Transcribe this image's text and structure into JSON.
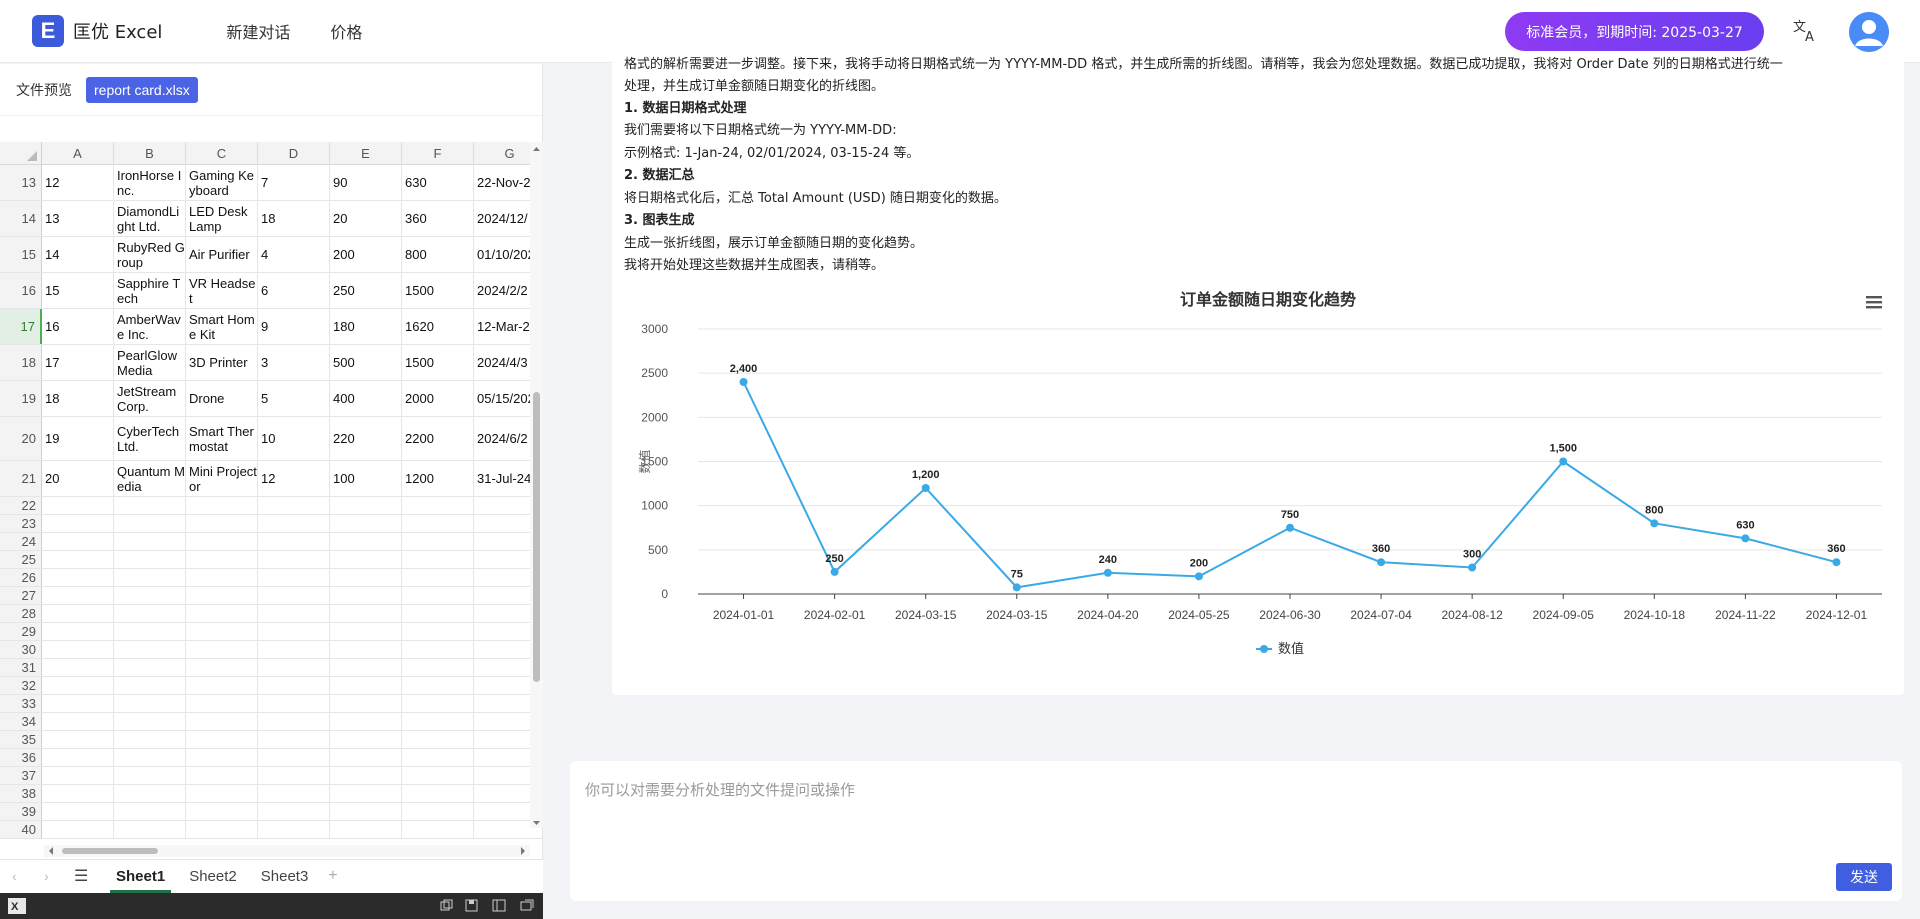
{
  "app": {
    "logo_letter": "E",
    "name": "匡优 Excel",
    "nav": [
      "新建对话",
      "价格"
    ],
    "member_badge": "标准会员，到期时间: 2025-03-27",
    "translate_glyph": "文A"
  },
  "file_preview": {
    "label": "文件预览",
    "file_name": "report card.xlsx"
  },
  "spreadsheet": {
    "columns": [
      "A",
      "B",
      "C",
      "D",
      "E",
      "F",
      "G"
    ],
    "rows": [
      {
        "num": "13",
        "cells": [
          "12",
          "IronHorse Inc.",
          "Gaming Keyboard",
          "7",
          "90",
          "630",
          "22-Nov-2"
        ]
      },
      {
        "num": "14",
        "cells": [
          "13",
          "DiamondLight Ltd.",
          "LED Desk Lamp",
          "18",
          "20",
          "360",
          "2024/12/"
        ]
      },
      {
        "num": "15",
        "cells": [
          "14",
          "RubyRed Group",
          "Air Purifier",
          "4",
          "200",
          "800",
          "01/10/2024"
        ]
      },
      {
        "num": "16",
        "cells": [
          "15",
          "Sapphire Tech",
          "VR Headset",
          "6",
          "250",
          "1500",
          "2024/2/2"
        ]
      },
      {
        "num": "17",
        "cells": [
          "16",
          "AmberWave Inc.",
          "Smart Home Kit",
          "9",
          "180",
          "1620",
          "12-Mar-2"
        ]
      },
      {
        "num": "18",
        "cells": [
          "17",
          "PearlGlow Media",
          "3D Printer",
          "3",
          "500",
          "1500",
          "2024/4/3"
        ]
      },
      {
        "num": "19",
        "cells": [
          "18",
          "JetStream Corp.",
          "Drone",
          "5",
          "400",
          "2000",
          "05/15/2024"
        ]
      },
      {
        "num": "20",
        "cells": [
          "19",
          "CyberTech Ltd.",
          "Smart Thermostat",
          "10",
          "220",
          "2200",
          "2024/6/2"
        ]
      },
      {
        "num": "21",
        "cells": [
          "20",
          "Quantum Media",
          "Mini Projector",
          "12",
          "100",
          "1200",
          "31-Jul-24"
        ]
      }
    ],
    "empty_rows": [
      "22",
      "23",
      "24",
      "25",
      "26",
      "27",
      "28",
      "29",
      "30",
      "31",
      "32",
      "33",
      "34",
      "35",
      "36",
      "37",
      "38",
      "39",
      "40"
    ],
    "active_row": "17",
    "sheets": [
      "Sheet1",
      "Sheet2",
      "Sheet3"
    ],
    "active_sheet": "Sheet1"
  },
  "chat": {
    "lines": [
      {
        "text": "格式的解析需要进一步调整。接下来，我将手动将日期格式统一为 YYYY-MM-DD 格式，并生成所需的折线图。请稍等，我会为您处理数据。数据已成功提取，我将对 Order Date 列的日期格式进行统一",
        "bold": false
      },
      {
        "text": "处理，并生成订单金额随日期变化的折线图。",
        "bold": false
      },
      {
        "text": "1. 数据日期格式处理",
        "bold": true
      },
      {
        "text": "我们需要将以下日期格式统一为 YYYY-MM-DD:",
        "bold": false
      },
      {
        "text": "示例格式: 1-Jan-24, 02/01/2024, 03-15-24 等。",
        "bold": false
      },
      {
        "text": "2. 数据汇总",
        "bold": true
      },
      {
        "text": "将日期格式化后，汇总 Total Amount (USD) 随日期变化的数据。",
        "bold": false
      },
      {
        "text": "3. 图表生成",
        "bold": true
      },
      {
        "text": "生成一张折线图，展示订单金额随日期的变化趋势。",
        "bold": false
      },
      {
        "text": "我将开始处理这些数据并生成图表，请稍等。",
        "bold": false
      }
    ]
  },
  "chart_data": {
    "type": "line",
    "title": "订单金额随日期变化趋势",
    "xlabel": "",
    "ylabel": "数值",
    "ylim": [
      0,
      3000
    ],
    "yticks": [
      "0",
      "500",
      "1000",
      "1500",
      "2000",
      "2500",
      "3000"
    ],
    "categories": [
      "2024-01-01",
      "2024-02-01",
      "2024-03-15",
      "2024-03-15",
      "2024-04-20",
      "2024-05-25",
      "2024-06-30",
      "2024-07-04",
      "2024-08-12",
      "2024-09-05",
      "2024-10-18",
      "2024-11-22",
      "2024-12-01"
    ],
    "series": [
      {
        "name": "数值",
        "values": [
          2400,
          250,
          1200,
          75,
          240,
          200,
          750,
          360,
          300,
          1500,
          800,
          630,
          360
        ]
      }
    ],
    "data_labels": [
      "2,400",
      "250",
      "1,200",
      "75",
      "240",
      "200",
      "750",
      "360",
      "300",
      "1,500",
      "800",
      "630",
      "360"
    ],
    "grid": true,
    "legend": "bottom-center",
    "color": "#3aa9e6",
    "menu_icon": "hamburger-menu-icon"
  },
  "input": {
    "placeholder": "你可以对需要分析处理的文件提问或操作",
    "send_label": "发送"
  },
  "colors": {
    "brand": "#3b5bdb",
    "badge": "#7b3cf2",
    "send": "#3f5fe0",
    "sheet_green": "#217346"
  }
}
